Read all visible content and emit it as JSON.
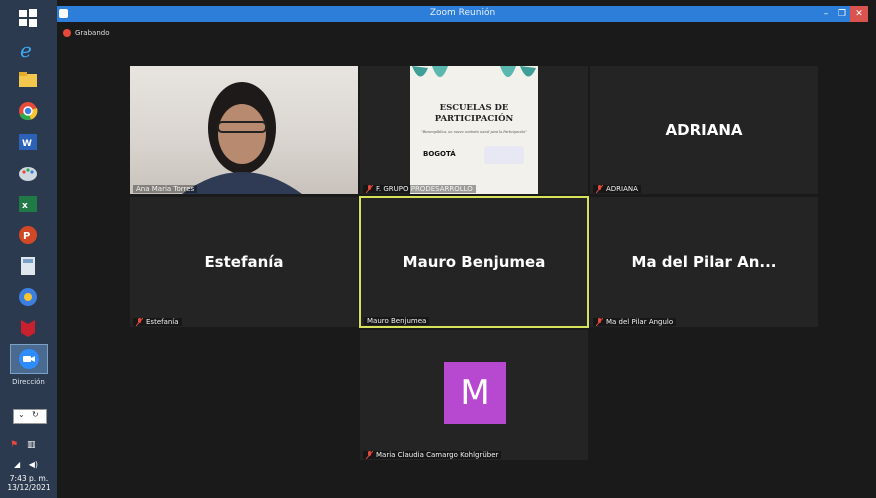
{
  "taskbar": {
    "language_label": "Dirección",
    "clock_time": "7:43 p. m.",
    "clock_date": "13/12/2021"
  },
  "window": {
    "title": "Zoom Reunión",
    "minimize_glyph": "–",
    "restore_glyph": "❐",
    "close_glyph": "✕"
  },
  "recording": {
    "label": "Grabando"
  },
  "tiles": [
    {
      "display": "",
      "label": "Ana Maria Torres",
      "muted": false,
      "type": "video"
    },
    {
      "display": "",
      "label": "F. GRUPO PRODESARROLLO",
      "muted": true,
      "type": "share"
    },
    {
      "display": "ADRIANA",
      "label": "ADRIANA",
      "muted": true,
      "type": "name"
    },
    {
      "display": "Estefanía",
      "label": "Estefanía",
      "muted": true,
      "type": "name"
    },
    {
      "display": "Mauro Benjumea",
      "label": "Mauro Benjumea",
      "muted": false,
      "type": "name",
      "speaking": true
    },
    {
      "display": "Ma del Pilar An...",
      "label": "Ma del Pilar Angulo",
      "muted": true,
      "type": "name"
    },
    {
      "display": "M",
      "label": "Maria Claudia Camargo Kohlgrüber",
      "muted": true,
      "type": "avatar"
    }
  ],
  "share": {
    "title_line1": "ESCUELAS DE",
    "title_line2": "PARTICIPACIÓN",
    "subtitle": "\"Bienespública, un nuevo contrato social para la Participación\"",
    "logo_text": "BOGOTÁ"
  },
  "colors": {
    "titlebar": "#2d7ed8",
    "speaking_border": "#d7e25b",
    "avatar_bg": "#b749d0",
    "muted_icon": "#e5493a"
  }
}
